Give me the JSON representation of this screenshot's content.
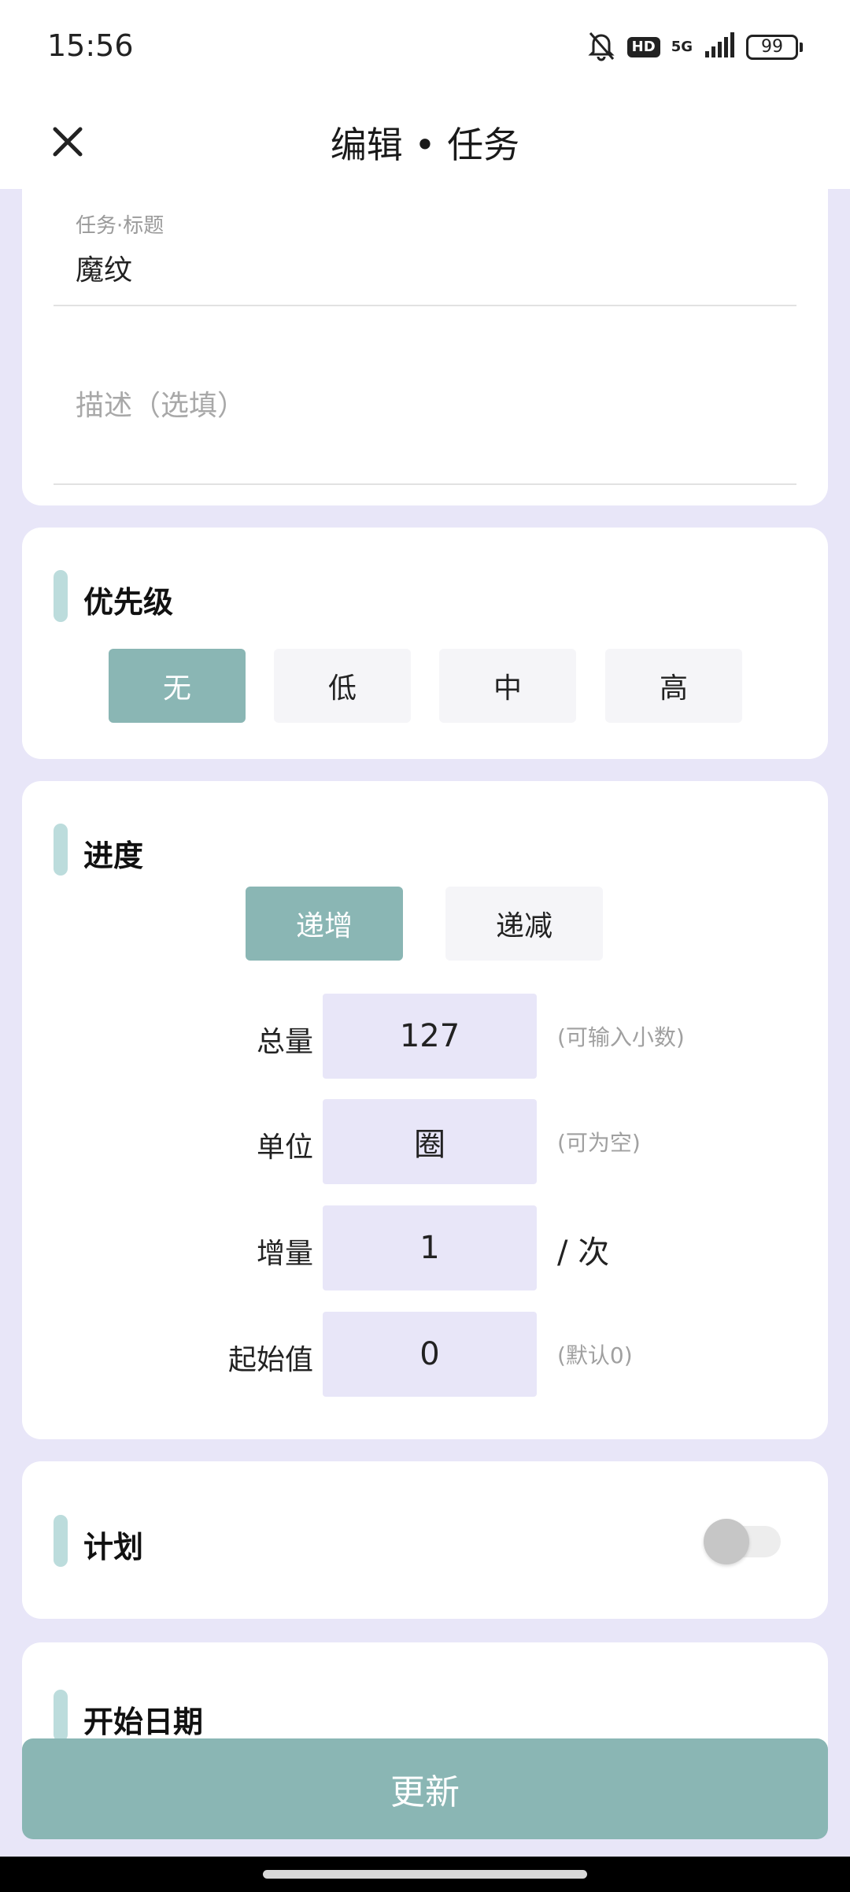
{
  "status_bar": {
    "time": "15:56",
    "hd": "HD",
    "network": "5G",
    "battery": "99"
  },
  "app_bar": {
    "title": "编辑 • 任务"
  },
  "task": {
    "title_label": "任务·标题",
    "title_value": "魔纹",
    "description_placeholder": "描述（选填）"
  },
  "priority": {
    "section_title": "优先级",
    "options": [
      "无",
      "低",
      "中",
      "高"
    ],
    "selected": "无"
  },
  "progress": {
    "section_title": "进度",
    "modes": [
      "递增",
      "递减"
    ],
    "selected_mode": "递增",
    "rows": [
      {
        "label": "总量",
        "value": "127",
        "hint": "(可输入小数)"
      },
      {
        "label": "单位",
        "value": "圈",
        "hint": "(可为空)"
      },
      {
        "label": "增量",
        "value": "1",
        "hint": "/ 次"
      },
      {
        "label": "起始值",
        "value": "0",
        "hint": "(默认0)"
      }
    ]
  },
  "plan": {
    "section_title": "计划",
    "enabled": false
  },
  "start_date": {
    "section_title": "开始日期"
  },
  "update_button": "更新",
  "colors": {
    "accent": "#8AB6B4",
    "background": "#E8E6F8",
    "section_bar": "#BCDCDC",
    "input_bg": "#E8E6F8"
  }
}
